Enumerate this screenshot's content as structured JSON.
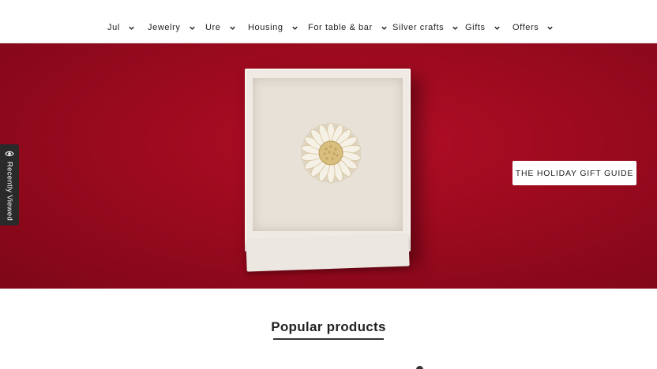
{
  "nav": {
    "items": [
      {
        "label": "Jul",
        "icon": "chevron-down-icon"
      },
      {
        "label": "Jewelry",
        "icon": "chevron-down-icon"
      },
      {
        "label": "Ure",
        "icon": "chevron-down-icon"
      },
      {
        "label": "Housing",
        "icon": "chevron-down-icon"
      },
      {
        "label": "For table & bar",
        "icon": "chevron-down-icon"
      },
      {
        "label": "Silver crafts",
        "icon": "chevron-down-icon"
      },
      {
        "label": "Gifts",
        "icon": "chevron-down-icon"
      },
      {
        "label": "Offers",
        "icon": "chevron-down-icon"
      }
    ]
  },
  "hero": {
    "cta_label": "THE HOLIDAY GIFT GUIDE",
    "background_color": "#9c0a1f"
  },
  "recently_viewed": {
    "label": "Recently Viewed",
    "icon": "eye-icon"
  },
  "popular": {
    "title": "Popular products"
  }
}
